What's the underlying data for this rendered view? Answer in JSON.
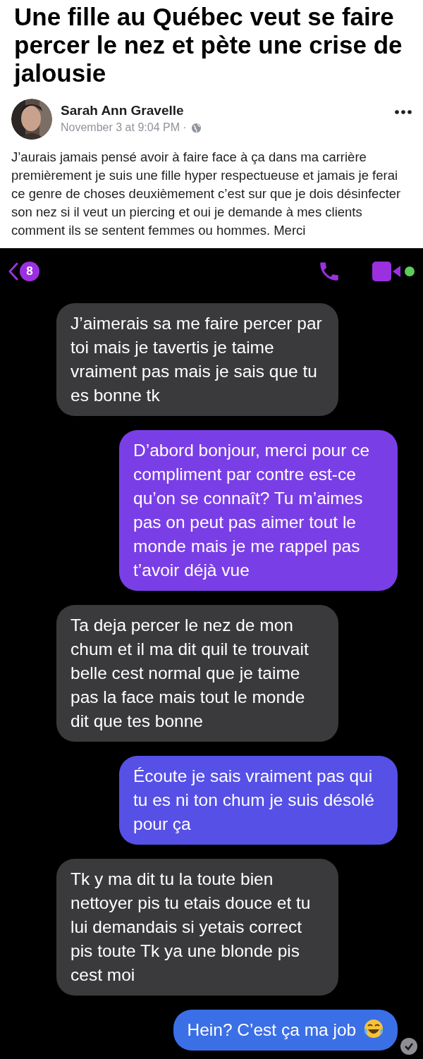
{
  "headline": "Une fille au Québec veut se faire percer le nez et pète une crise de jalousie",
  "post": {
    "author": "Sarah Ann Gravelle",
    "time": "November 3 at 9:04 PM ·",
    "text": "J’aurais jamais pensé avoir à faire face à ça dans ma carrière premièrement je suis une fille hyper respectueuse et jamais je ferai ce genre de choses deuxièmement c’est sur que je dois désinfecter son nez si il veut un piercing et oui je demande à mes clients comment ils se sentent femmes ou hommes. Merci"
  },
  "chat": {
    "unread_count": "8",
    "online": true,
    "messages": [
      {
        "kind": "received",
        "text": "J’aimerais sa me faire percer par toi mais je tavertis je taime vraiment pas mais je sais que tu es bonne tk"
      },
      {
        "kind": "sent",
        "color": "#7a3ee6",
        "text": "D’abord bonjour, merci pour ce compliment par contre est-ce qu’on se connaît? Tu m’aimes pas on peut pas aimer tout le monde mais je me rappel pas t’avoir déjà vue"
      },
      {
        "kind": "received",
        "text": "Ta deja percer le nez de mon chum et il ma dit quil te trouvait belle cest normal que je taime pas la face mais tout le monde dit que tes bonne"
      },
      {
        "kind": "sent",
        "color": "#5650e6",
        "text": "Écoute je sais vraiment pas qui tu es ni ton chum je suis désolé pour ça"
      },
      {
        "kind": "received",
        "text": "Tk y ma dit tu la toute bien nettoyer pis tu etais douce et tu lui demandais si yetais correct pis toute Tk ya une blonde pis cest moi"
      },
      {
        "kind": "sent",
        "color": "#3b6fe6",
        "text": "Hein? C’est ça ma job",
        "emoji": true,
        "seen": true
      }
    ]
  }
}
